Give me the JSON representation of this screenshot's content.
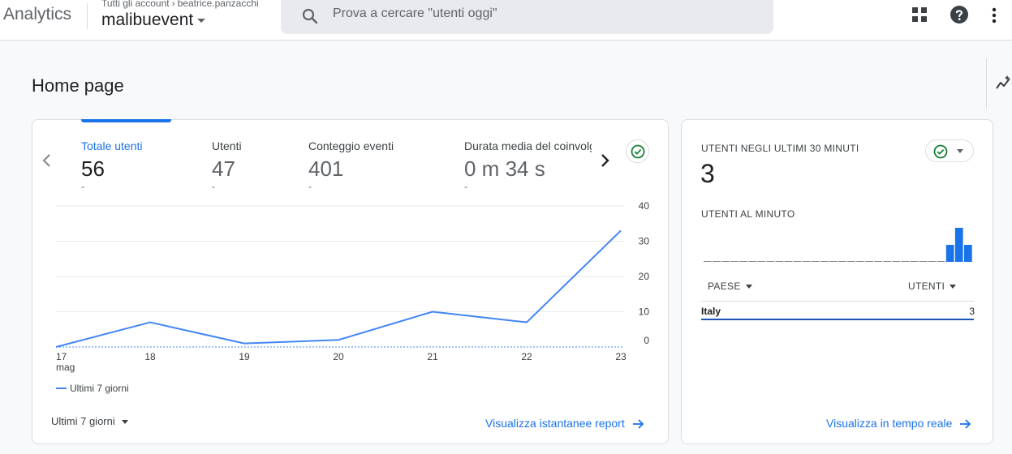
{
  "header": {
    "app_name": "Analytics",
    "breadcrumb_root": "Tutti gli account",
    "breadcrumb_account": "beatrice.panzacchi",
    "property_name": "malibuevent",
    "search_placeholder": "Prova a cercare \"utenti oggi\"",
    "icons": [
      "search-icon",
      "apps-icon",
      "help-icon",
      "more-vert-icon"
    ]
  },
  "page": {
    "title": "Home page"
  },
  "overview_card": {
    "metrics": [
      {
        "label": "Totale utenti",
        "value": "56",
        "delta": "-"
      },
      {
        "label": "Utenti",
        "value": "47",
        "delta": "-"
      },
      {
        "label": "Conteggio eventi",
        "value": "401",
        "delta": "-"
      },
      {
        "label": "Durata media del coinvolgimento",
        "value": "0 m 34 s",
        "delta": "-"
      }
    ],
    "legend_label": "Ultimi 7 giorni",
    "date_range": "Ultimi 7 giorni",
    "link": "Visualizza istantanee report"
  },
  "chart_data": {
    "type": "line",
    "x": [
      "17",
      "18",
      "19",
      "20",
      "21",
      "22",
      "23"
    ],
    "x_sub": [
      "mag",
      "",
      "",
      "",
      "",
      "",
      ""
    ],
    "series": [
      {
        "name": "Ultimi 7 giorni",
        "values": [
          0,
          7,
          1,
          2,
          10,
          7,
          33
        ]
      }
    ],
    "yticks": [
      "0",
      "10",
      "20",
      "30",
      "40"
    ],
    "ylim": [
      0,
      40
    ],
    "grid": true,
    "legend_position": "bottom-left",
    "color": "#4285f4"
  },
  "realtime_card": {
    "title": "UTENTI NEGLI ULTIMI 30 MINUTI",
    "value": "3",
    "per_minute_label": "UTENTI AL MINUTO",
    "per_minute_values": [
      0,
      0,
      0,
      0,
      0,
      0,
      0,
      0,
      0,
      0,
      0,
      0,
      0,
      0,
      0,
      0,
      0,
      0,
      0,
      0,
      0,
      0,
      0,
      0,
      0,
      0,
      0,
      1,
      2,
      1
    ],
    "table_header_country": "PAESE",
    "table_header_users": "UTENTI",
    "rows": [
      {
        "country": "Italy",
        "users": "3"
      }
    ],
    "link": "Visualizza in tempo reale"
  },
  "colors": {
    "accent": "#1a73e8",
    "line": "#4285f4",
    "success": "#188038"
  }
}
